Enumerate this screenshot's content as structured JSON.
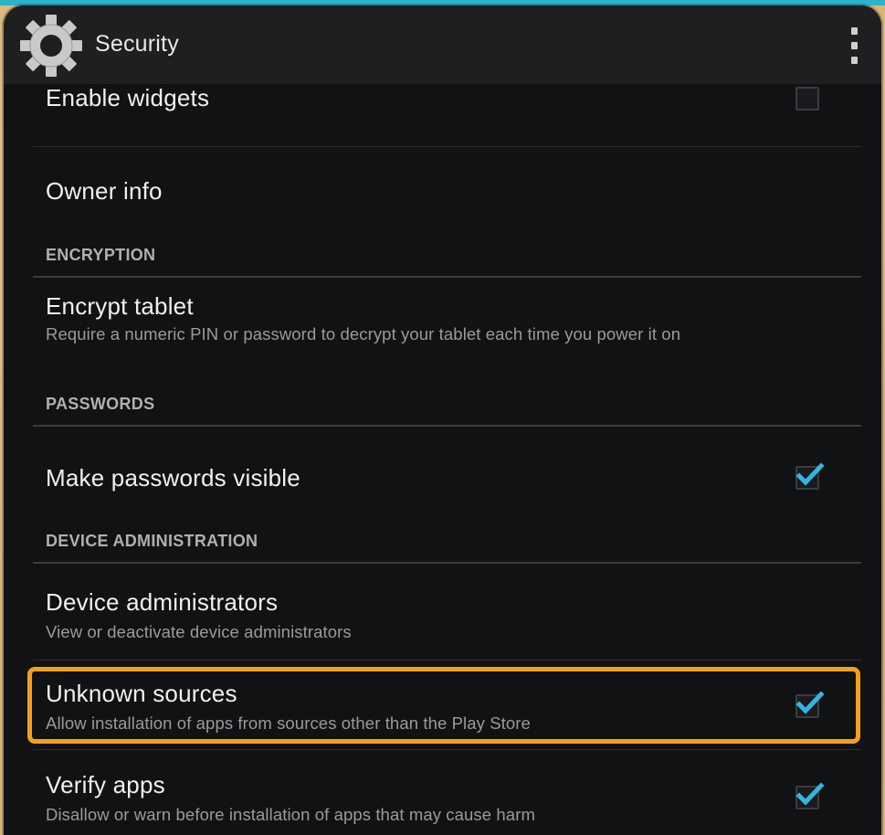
{
  "colors": {
    "accent": "#33b5e5",
    "highlight": "#f5a01c",
    "background": "#111214",
    "action_bar": "#1e1f21"
  },
  "action_bar": {
    "icon": "gear-icon",
    "title": "Security",
    "menu_icon": "overflow-menu-icon"
  },
  "items": {
    "enable_widgets": {
      "title": "Enable widgets",
      "checked": false
    },
    "owner_info": {
      "title": "Owner info"
    },
    "encrypt_tablet": {
      "title": "Encrypt tablet",
      "summary": "Require a numeric PIN or password to decrypt your tablet each time you power it on"
    },
    "make_passwords_visible": {
      "title": "Make passwords visible",
      "checked": true
    },
    "device_administrators": {
      "title": "Device administrators",
      "summary": "View or deactivate device administrators"
    },
    "unknown_sources": {
      "title": "Unknown sources",
      "summary": "Allow installation of apps from sources other than the Play Store",
      "checked": true
    },
    "verify_apps": {
      "title": "Verify apps",
      "summary": "Disallow or warn before installation of apps that may cause harm",
      "checked": true
    }
  },
  "categories": {
    "encryption": "ENCRYPTION",
    "passwords": "PASSWORDS",
    "device_administration": "DEVICE ADMINISTRATION"
  }
}
